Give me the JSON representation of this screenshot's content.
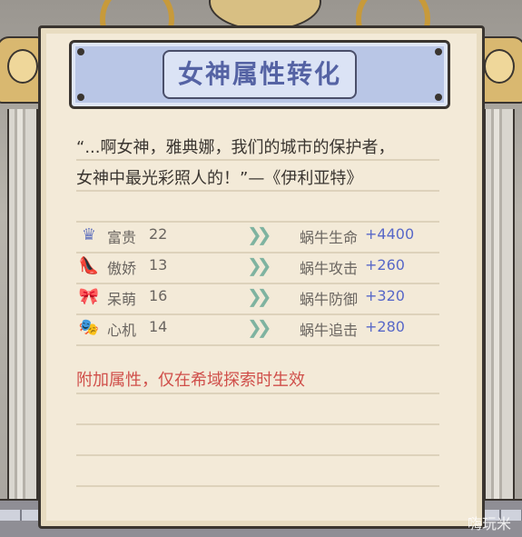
{
  "title": "女神属性转化",
  "quote": {
    "line1": "“...啊女神，雅典娜，我们的城市的保护者，",
    "line2": "女神中最光彩照人的！”—《伊利亚特》"
  },
  "stats": [
    {
      "icon": "crown-icon",
      "glyph": "♛",
      "glyph_color": "#6d7bbf",
      "name": "富贵",
      "value": "22",
      "arrow": "❯❯",
      "attribute": "蜗牛生命",
      "bonus": "+4400"
    },
    {
      "icon": "high-heel-icon",
      "glyph": "👠",
      "glyph_color": "#d98f8f",
      "name": "傲娇",
      "value": "13",
      "arrow": "❯❯",
      "attribute": "蜗牛攻击",
      "bonus": "+260"
    },
    {
      "icon": "bow-icon",
      "glyph": "🎀",
      "glyph_color": "#6fbfc9",
      "name": "呆萌",
      "value": "16",
      "arrow": "❯❯",
      "attribute": "蜗牛防御",
      "bonus": "+320"
    },
    {
      "icon": "mask-icon",
      "glyph": "🎭",
      "glyph_color": "#a98fc8",
      "name": "心机",
      "value": "14",
      "arrow": "❯❯",
      "attribute": "蜗牛追击",
      "bonus": "+280"
    }
  ],
  "note": "附加属性，仅在希域探索时生效",
  "watermark": "嗨玩米",
  "colors": {
    "title_text": "#5563a4",
    "bonus_text": "#5868c8",
    "note_text": "#d04f4a",
    "banner_bg": "#b9c6e6",
    "paper_bg": "#f3ead8"
  }
}
